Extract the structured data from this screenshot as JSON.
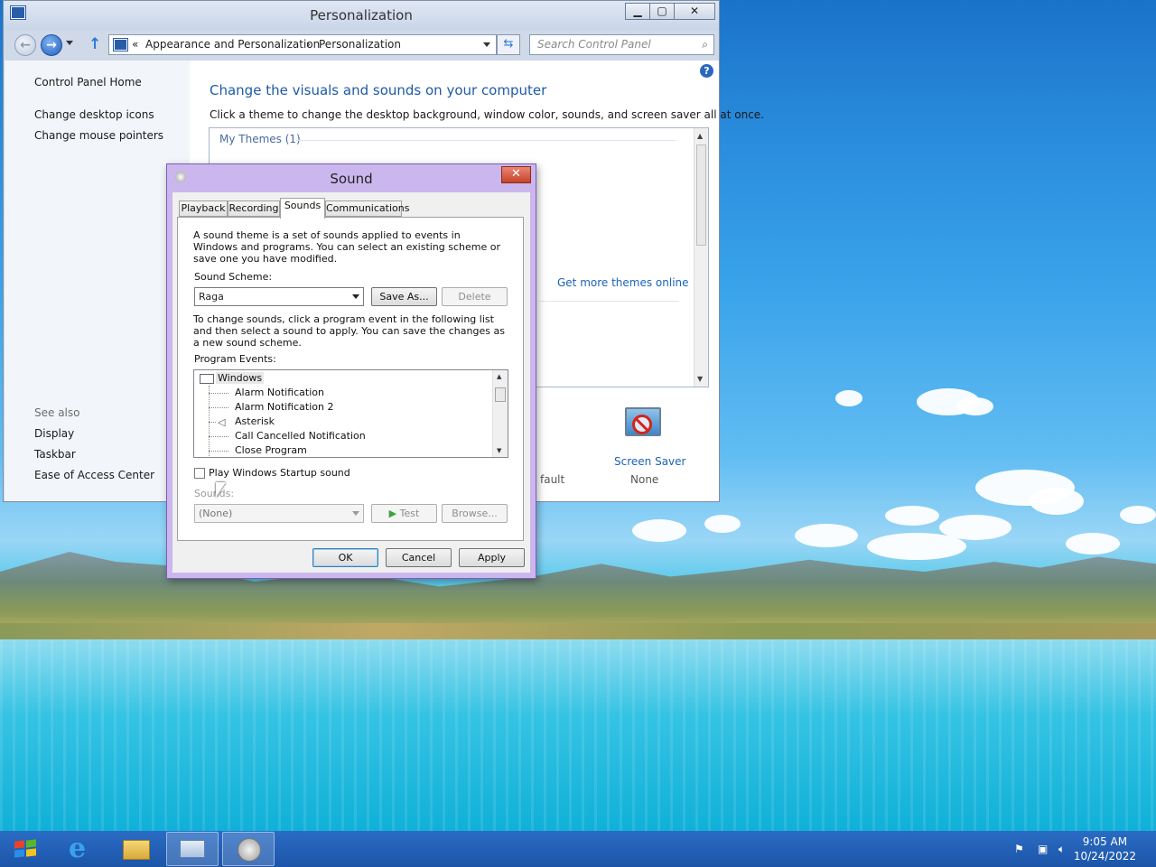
{
  "colors": {
    "accent": "#1a63b8",
    "dialog_frame": "#cbb7ee",
    "taskbar": "#1c55a8"
  },
  "control_panel": {
    "title": "Personalization",
    "caption_minimize": "▁",
    "caption_maximize": "▢",
    "caption_close": "✕",
    "breadcrumb_prefix": "«",
    "breadcrumb_parent": "Appearance and Personalization",
    "breadcrumb_sep": "›",
    "breadcrumb_current": "Personalization",
    "search_placeholder": "Search Control Panel",
    "sidebar": {
      "home": "Control Panel Home",
      "desktop_icons": "Change desktop icons",
      "mouse_pointers": "Change mouse pointers",
      "see_also": "See also",
      "display": "Display",
      "taskbar": "Taskbar",
      "ease_access": "Ease of Access Center"
    },
    "heading": "Change the visuals and sounds on your computer",
    "subheading": "Click a theme to change the desktop background, window color, sounds, and screen saver all at once.",
    "my_themes": "My Themes (1)",
    "get_more_themes": "Get more themes online",
    "screen_saver_label": "Screen Saver",
    "screen_saver_value": "None",
    "partial_default": "fault",
    "help_icon": "?"
  },
  "sound_dialog": {
    "title": "Sound",
    "close": "✕",
    "tabs": [
      "Playback",
      "Recording",
      "Sounds",
      "Communications"
    ],
    "active_tab": "Sounds",
    "intro": "A sound theme is a set of sounds applied to events in Windows and programs.  You can select an existing scheme or save one you have modified.",
    "scheme_label": "Sound Scheme:",
    "scheme_value": "Raga",
    "save_as": "Save As...",
    "delete": "Delete",
    "instructions": "To change sounds, click a program event in the following list and then select a sound to apply.  You can save the changes as a new sound scheme.",
    "events_label": "Program Events:",
    "events": {
      "group": "Windows",
      "items": [
        "Alarm Notification",
        "Alarm Notification 2",
        "Asterisk",
        "Call Cancelled Notification",
        "Close Program"
      ]
    },
    "startup_checkbox": "Play Windows Startup sound",
    "startup_checked": false,
    "sounds_label": "Sounds:",
    "sounds_value": "(None)",
    "test": "Test",
    "browse": "Browse...",
    "ok": "OK",
    "cancel": "Cancel",
    "apply": "Apply"
  },
  "taskbar": {
    "time": "9:05 AM",
    "date": "10/24/2022"
  }
}
